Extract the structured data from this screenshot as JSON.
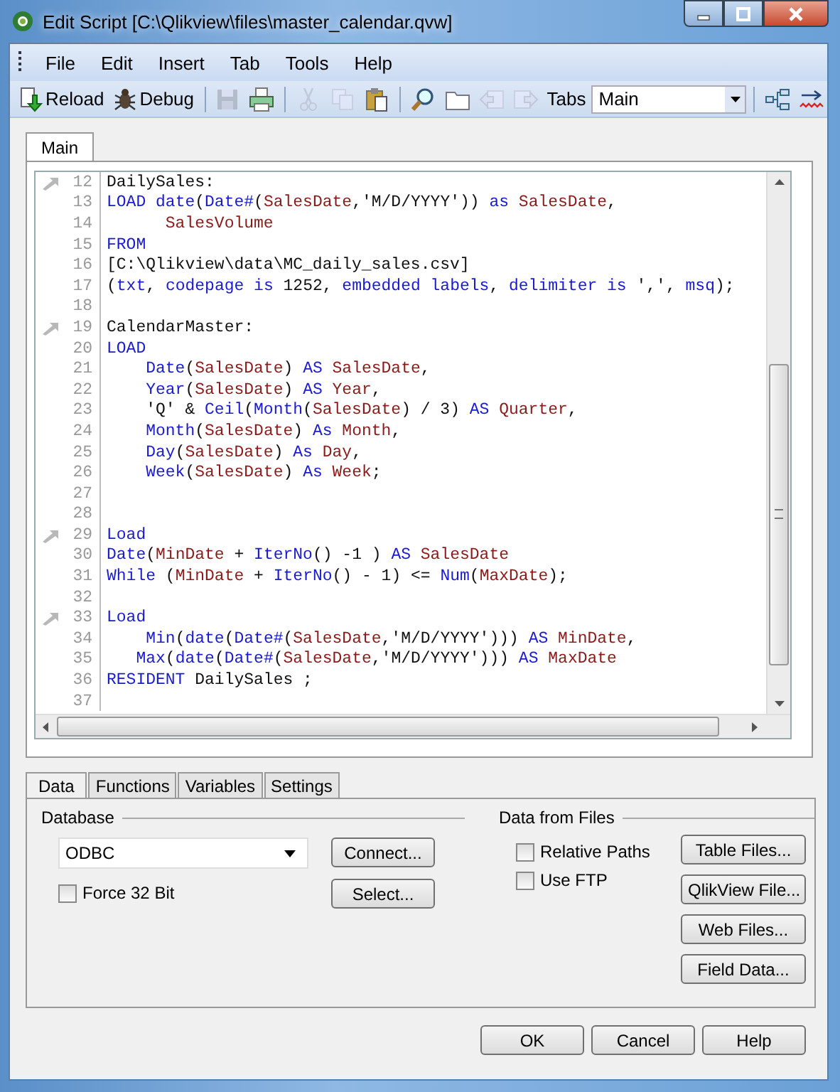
{
  "window": {
    "title": "Edit Script [C:\\Qlikview\\files\\master_calendar.qvw]"
  },
  "menu": [
    "File",
    "Edit",
    "Insert",
    "Tab",
    "Tools",
    "Help"
  ],
  "toolbar": [
    {
      "kind": "reload",
      "label": "Reload",
      "disabled": false
    },
    {
      "kind": "debug",
      "label": "Debug",
      "disabled": false
    },
    {
      "kind": "sep"
    },
    {
      "kind": "save",
      "disabled": true
    },
    {
      "kind": "print",
      "disabled": false
    },
    {
      "kind": "sep"
    },
    {
      "kind": "cut",
      "disabled": true
    },
    {
      "kind": "copy",
      "disabled": true
    },
    {
      "kind": "paste",
      "disabled": false
    },
    {
      "kind": "sep"
    },
    {
      "kind": "find",
      "disabled": false
    },
    {
      "kind": "folder",
      "disabled": false
    },
    {
      "kind": "tab-left",
      "disabled": true
    },
    {
      "kind": "tab-right",
      "disabled": true
    },
    {
      "kind": "label",
      "label": "Tabs"
    },
    {
      "kind": "combo",
      "value": "Main"
    },
    {
      "kind": "sep"
    },
    {
      "kind": "tree",
      "disabled": false
    },
    {
      "kind": "wave",
      "disabled": false
    }
  ],
  "script_tabs": [
    {
      "label": "Main",
      "selected": true
    }
  ],
  "lines": [
    {
      "number": "12",
      "marker": true,
      "tokens": [
        {
          "kind": "plain",
          "text": "DailySales:"
        }
      ]
    },
    {
      "number": "13",
      "marker": false,
      "tokens": [
        {
          "kind": "kw",
          "text": "LOAD"
        },
        {
          "kind": "kw",
          "text": " date"
        },
        {
          "kind": "plain",
          "text": "("
        },
        {
          "kind": "kw",
          "text": "Date#"
        },
        {
          "kind": "plain",
          "text": "("
        },
        {
          "kind": "field",
          "text": "SalesDate"
        },
        {
          "kind": "plain",
          "text": ",'M/D/YYYY')) "
        },
        {
          "kind": "kw",
          "text": "as"
        },
        {
          "kind": "field",
          "text": " SalesDate"
        },
        {
          "kind": "plain",
          "text": ","
        }
      ]
    },
    {
      "number": "14",
      "marker": false,
      "tokens": [
        {
          "kind": "field",
          "text": "      SalesVolume"
        }
      ]
    },
    {
      "number": "15",
      "marker": false,
      "tokens": [
        {
          "kind": "kw",
          "text": "FROM"
        }
      ]
    },
    {
      "number": "16",
      "marker": false,
      "tokens": [
        {
          "kind": "plain",
          "text": "[C:\\Qlikview\\data\\MC_daily_sales.csv]"
        }
      ]
    },
    {
      "number": "17",
      "marker": false,
      "tokens": [
        {
          "kind": "plain",
          "text": "("
        },
        {
          "kind": "kw",
          "text": "txt"
        },
        {
          "kind": "plain",
          "text": ", "
        },
        {
          "kind": "kw",
          "text": "codepage is"
        },
        {
          "kind": "plain",
          "text": " 1252, "
        },
        {
          "kind": "kw",
          "text": "embedded labels"
        },
        {
          "kind": "plain",
          "text": ", "
        },
        {
          "kind": "kw",
          "text": "delimiter is"
        },
        {
          "kind": "plain",
          "text": " ',', "
        },
        {
          "kind": "kw",
          "text": "msq"
        },
        {
          "kind": "plain",
          "text": ");"
        }
      ]
    },
    {
      "number": "18",
      "marker": false
    },
    {
      "number": "19",
      "marker": true,
      "tokens": [
        {
          "kind": "plain",
          "text": "CalendarMaster:"
        }
      ]
    },
    {
      "number": "20",
      "marker": false,
      "tokens": [
        {
          "kind": "kw",
          "text": "LOAD"
        }
      ]
    },
    {
      "number": "21",
      "marker": false,
      "tokens": [
        {
          "kind": "kw",
          "text": "    Date"
        },
        {
          "kind": "plain",
          "text": "("
        },
        {
          "kind": "field",
          "text": "SalesDate"
        },
        {
          "kind": "plain",
          "text": ") "
        },
        {
          "kind": "kw",
          "text": "AS"
        },
        {
          "kind": "field",
          "text": " SalesDate"
        },
        {
          "kind": "plain",
          "text": ","
        }
      ]
    },
    {
      "number": "22",
      "marker": false,
      "tokens": [
        {
          "kind": "kw",
          "text": "    Year"
        },
        {
          "kind": "plain",
          "text": "("
        },
        {
          "kind": "field",
          "text": "SalesDate"
        },
        {
          "kind": "plain",
          "text": ") "
        },
        {
          "kind": "kw",
          "text": "AS"
        },
        {
          "kind": "field",
          "text": " Year"
        },
        {
          "kind": "plain",
          "text": ","
        }
      ]
    },
    {
      "number": "23",
      "marker": false,
      "tokens": [
        {
          "kind": "plain",
          "text": "    'Q' & "
        },
        {
          "kind": "kw",
          "text": "Ceil"
        },
        {
          "kind": "plain",
          "text": "("
        },
        {
          "kind": "kw",
          "text": "Month"
        },
        {
          "kind": "plain",
          "text": "("
        },
        {
          "kind": "field",
          "text": "SalesDate"
        },
        {
          "kind": "plain",
          "text": ") / 3) "
        },
        {
          "kind": "kw",
          "text": "AS"
        },
        {
          "kind": "field",
          "text": " Quarter"
        },
        {
          "kind": "plain",
          "text": ","
        }
      ]
    },
    {
      "number": "24",
      "marker": false,
      "tokens": [
        {
          "kind": "kw",
          "text": "    Month"
        },
        {
          "kind": "plain",
          "text": "("
        },
        {
          "kind": "field",
          "text": "SalesDate"
        },
        {
          "kind": "plain",
          "text": ") "
        },
        {
          "kind": "kw",
          "text": "As"
        },
        {
          "kind": "field",
          "text": " Month"
        },
        {
          "kind": "plain",
          "text": ","
        }
      ]
    },
    {
      "number": "25",
      "marker": false,
      "tokens": [
        {
          "kind": "kw",
          "text": "    Day"
        },
        {
          "kind": "plain",
          "text": "("
        },
        {
          "kind": "field",
          "text": "SalesDate"
        },
        {
          "kind": "plain",
          "text": ") "
        },
        {
          "kind": "kw",
          "text": "As"
        },
        {
          "kind": "field",
          "text": " Day"
        },
        {
          "kind": "plain",
          "text": ","
        }
      ]
    },
    {
      "number": "26",
      "marker": false,
      "tokens": [
        {
          "kind": "kw",
          "text": "    Week"
        },
        {
          "kind": "plain",
          "text": "("
        },
        {
          "kind": "field",
          "text": "SalesDate"
        },
        {
          "kind": "plain",
          "text": ") "
        },
        {
          "kind": "kw",
          "text": "As"
        },
        {
          "kind": "field",
          "text": " Week"
        },
        {
          "kind": "plain",
          "text": ";"
        }
      ]
    },
    {
      "number": "27",
      "marker": false
    },
    {
      "number": "28",
      "marker": false
    },
    {
      "number": "29",
      "marker": true,
      "tokens": [
        {
          "kind": "kw",
          "text": "Load"
        }
      ]
    },
    {
      "number": "30",
      "marker": false,
      "tokens": [
        {
          "kind": "kw",
          "text": "Date"
        },
        {
          "kind": "plain",
          "text": "("
        },
        {
          "kind": "field",
          "text": "MinDate"
        },
        {
          "kind": "plain",
          "text": " + "
        },
        {
          "kind": "kw",
          "text": "IterNo"
        },
        {
          "kind": "plain",
          "text": "() -1 ) "
        },
        {
          "kind": "kw",
          "text": "AS"
        },
        {
          "kind": "field",
          "text": " SalesDate"
        }
      ]
    },
    {
      "number": "31",
      "marker": false,
      "tokens": [
        {
          "kind": "kw",
          "text": "While"
        },
        {
          "kind": "plain",
          "text": " ("
        },
        {
          "kind": "field",
          "text": "MinDate"
        },
        {
          "kind": "plain",
          "text": " + "
        },
        {
          "kind": "kw",
          "text": "IterNo"
        },
        {
          "kind": "plain",
          "text": "() - 1) <= "
        },
        {
          "kind": "kw",
          "text": "Num"
        },
        {
          "kind": "plain",
          "text": "("
        },
        {
          "kind": "field",
          "text": "MaxDate"
        },
        {
          "kind": "plain",
          "text": ");"
        }
      ]
    },
    {
      "number": "32",
      "marker": false
    },
    {
      "number": "33",
      "marker": true,
      "tokens": [
        {
          "kind": "kw",
          "text": "Load"
        }
      ]
    },
    {
      "number": "34",
      "marker": false,
      "tokens": [
        {
          "kind": "kw",
          "text": "    Min"
        },
        {
          "kind": "plain",
          "text": "("
        },
        {
          "kind": "kw",
          "text": "date"
        },
        {
          "kind": "plain",
          "text": "("
        },
        {
          "kind": "kw",
          "text": "Date#"
        },
        {
          "kind": "plain",
          "text": "("
        },
        {
          "kind": "field",
          "text": "SalesDate"
        },
        {
          "kind": "plain",
          "text": ",'M/D/YYYY'))) "
        },
        {
          "kind": "kw",
          "text": "AS"
        },
        {
          "kind": "field",
          "text": " MinDate"
        },
        {
          "kind": "plain",
          "text": ","
        }
      ]
    },
    {
      "number": "35",
      "marker": false,
      "tokens": [
        {
          "kind": "kw",
          "text": "   Max"
        },
        {
          "kind": "plain",
          "text": "("
        },
        {
          "kind": "kw",
          "text": "date"
        },
        {
          "kind": "plain",
          "text": "("
        },
        {
          "kind": "kw",
          "text": "Date#"
        },
        {
          "kind": "plain",
          "text": "("
        },
        {
          "kind": "field",
          "text": "SalesDate"
        },
        {
          "kind": "plain",
          "text": ",'M/D/YYYY'))) "
        },
        {
          "kind": "kw",
          "text": "AS"
        },
        {
          "kind": "field",
          "text": " MaxDate"
        }
      ]
    },
    {
      "number": "36",
      "marker": false,
      "tokens": [
        {
          "kind": "kw",
          "text": "RESIDENT"
        },
        {
          "kind": "plain",
          "text": " DailySales ;"
        }
      ]
    },
    {
      "number": "37",
      "marker": false
    }
  ],
  "panel_tabs": [
    {
      "label": "Data",
      "selected": true
    },
    {
      "label": "Functions",
      "selected": false
    },
    {
      "label": "Variables",
      "selected": false
    },
    {
      "label": "Settings",
      "selected": false
    }
  ],
  "database": {
    "title": "Database",
    "dropdown": "ODBC",
    "checkbox": {
      "label": "Force 32 Bit",
      "checked": false
    },
    "buttons": [
      "Connect...",
      "Select..."
    ]
  },
  "data_from_files": {
    "title": "Data from Files",
    "checkboxes": [
      {
        "label": "Relative Paths",
        "checked": false
      },
      {
        "label": "Use FTP",
        "checked": false
      }
    ],
    "buttons": [
      "Table Files...",
      "QlikView File...",
      "Web Files...",
      "Field Data..."
    ]
  },
  "dialog_buttons": [
    "OK",
    "Cancel",
    "Help"
  ]
}
